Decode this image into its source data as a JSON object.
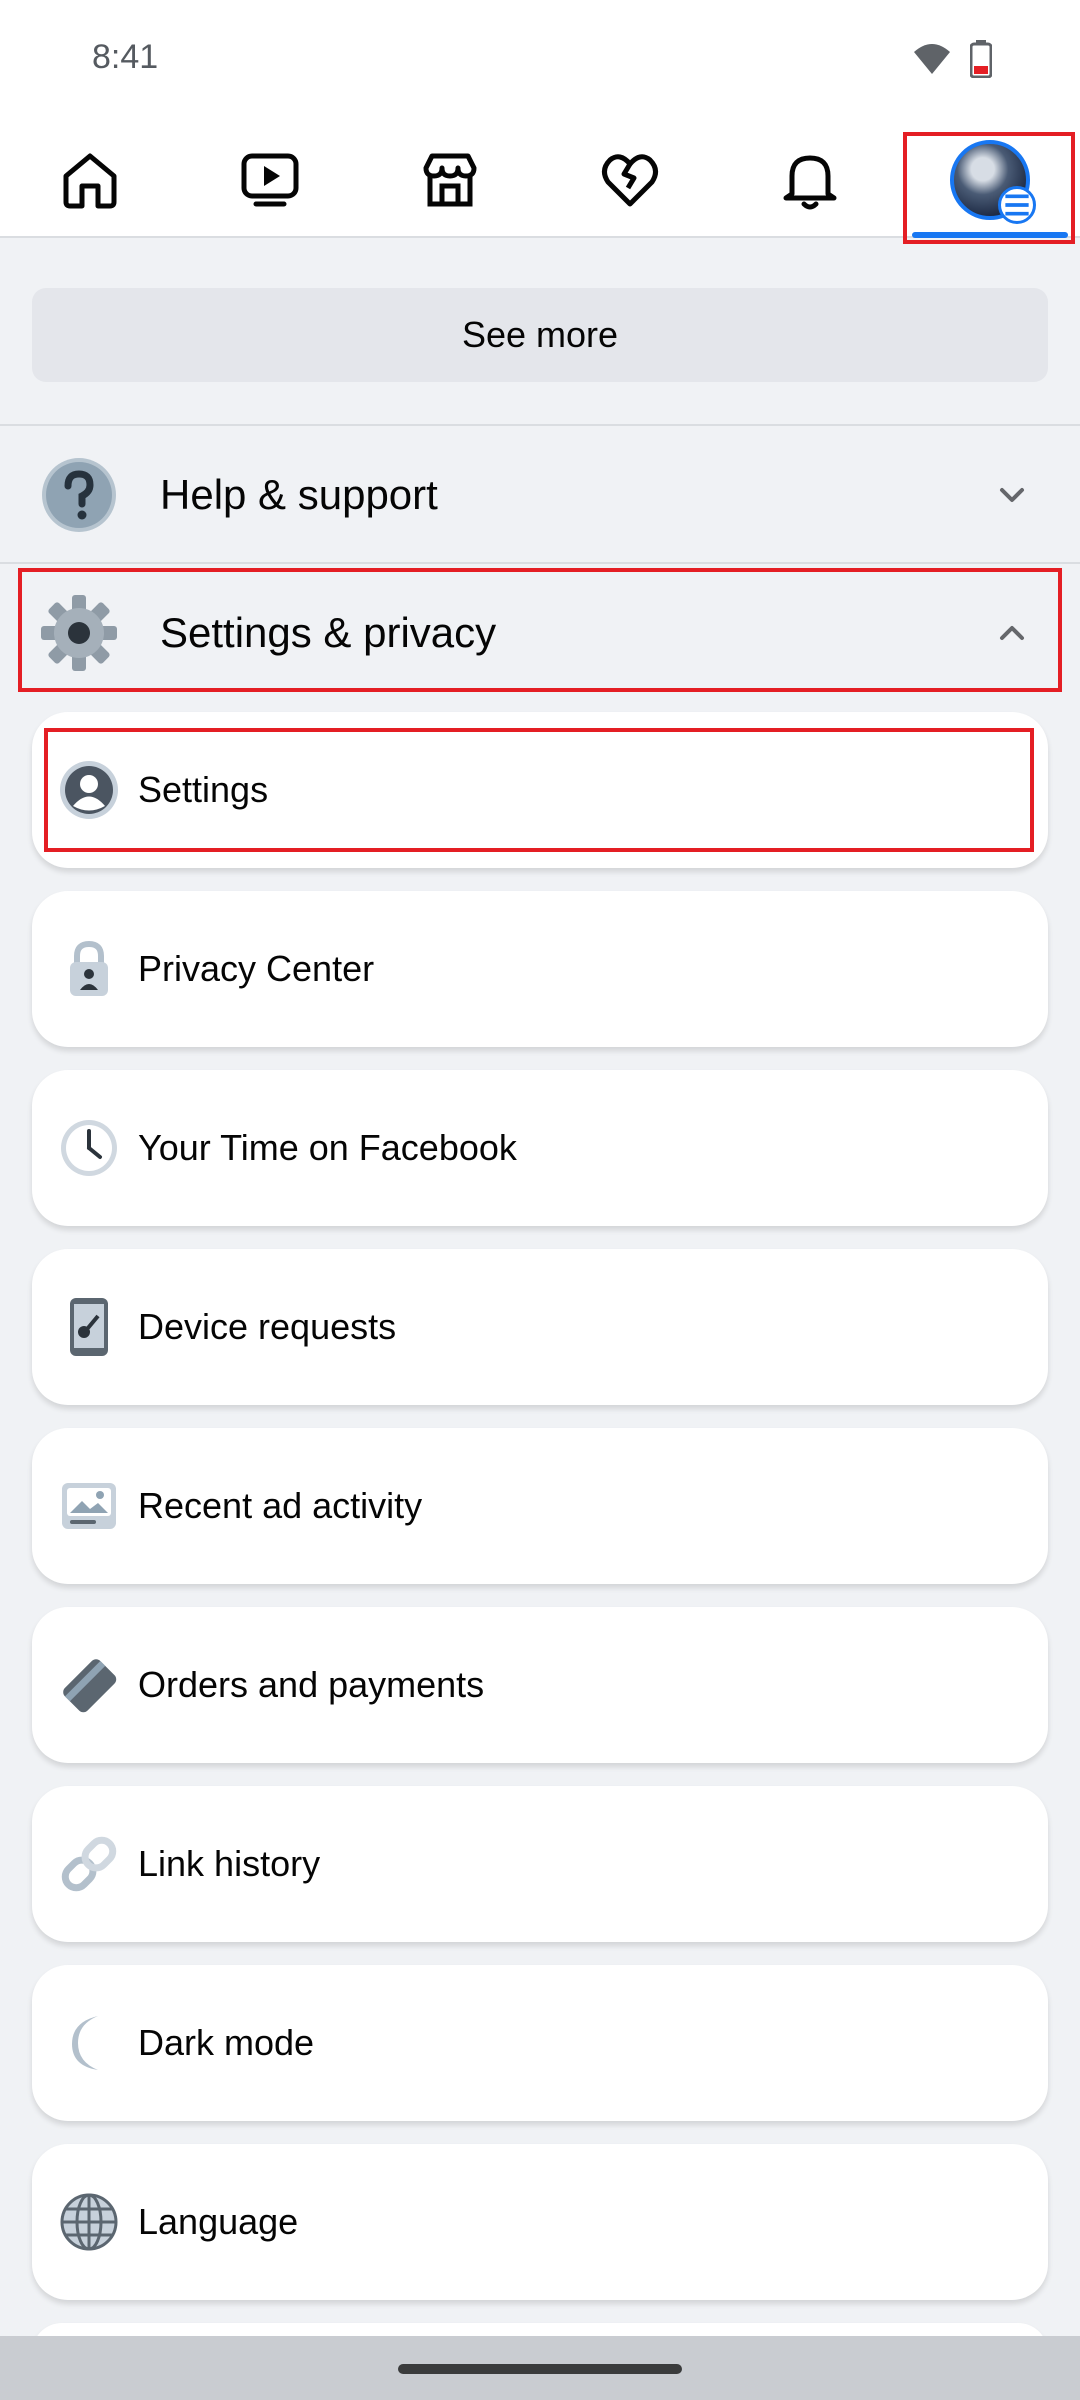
{
  "status_bar": {
    "time": "8:41"
  },
  "nav": {
    "tabs": [
      {
        "icon": "home-icon"
      },
      {
        "icon": "video-icon"
      },
      {
        "icon": "marketplace-icon"
      },
      {
        "icon": "dating-heart-icon"
      },
      {
        "icon": "bell-icon"
      },
      {
        "icon": "profile-menu-icon",
        "active": true
      }
    ]
  },
  "see_more": {
    "label": "See more"
  },
  "sections": {
    "help": {
      "title": "Help & support",
      "icon": "question-icon",
      "expanded": false
    },
    "settings": {
      "title": "Settings & privacy",
      "icon": "gear-icon",
      "expanded": true
    }
  },
  "menu_items": [
    {
      "label": "Settings",
      "icon": "person-icon"
    },
    {
      "label": "Privacy Center",
      "icon": "lock-icon"
    },
    {
      "label": "Your Time on Facebook",
      "icon": "clock-icon"
    },
    {
      "label": "Device requests",
      "icon": "phone-key-icon"
    },
    {
      "label": "Recent ad activity",
      "icon": "ad-activity-icon"
    },
    {
      "label": "Orders and payments",
      "icon": "credit-card-icon"
    },
    {
      "label": "Link history",
      "icon": "link-icon"
    },
    {
      "label": "Dark mode",
      "icon": "moon-icon"
    },
    {
      "label": "Language",
      "icon": "globe-icon"
    }
  ],
  "colors": {
    "accent": "#1877f2",
    "highlight": "#e41e24",
    "background": "#f0f2f5"
  }
}
